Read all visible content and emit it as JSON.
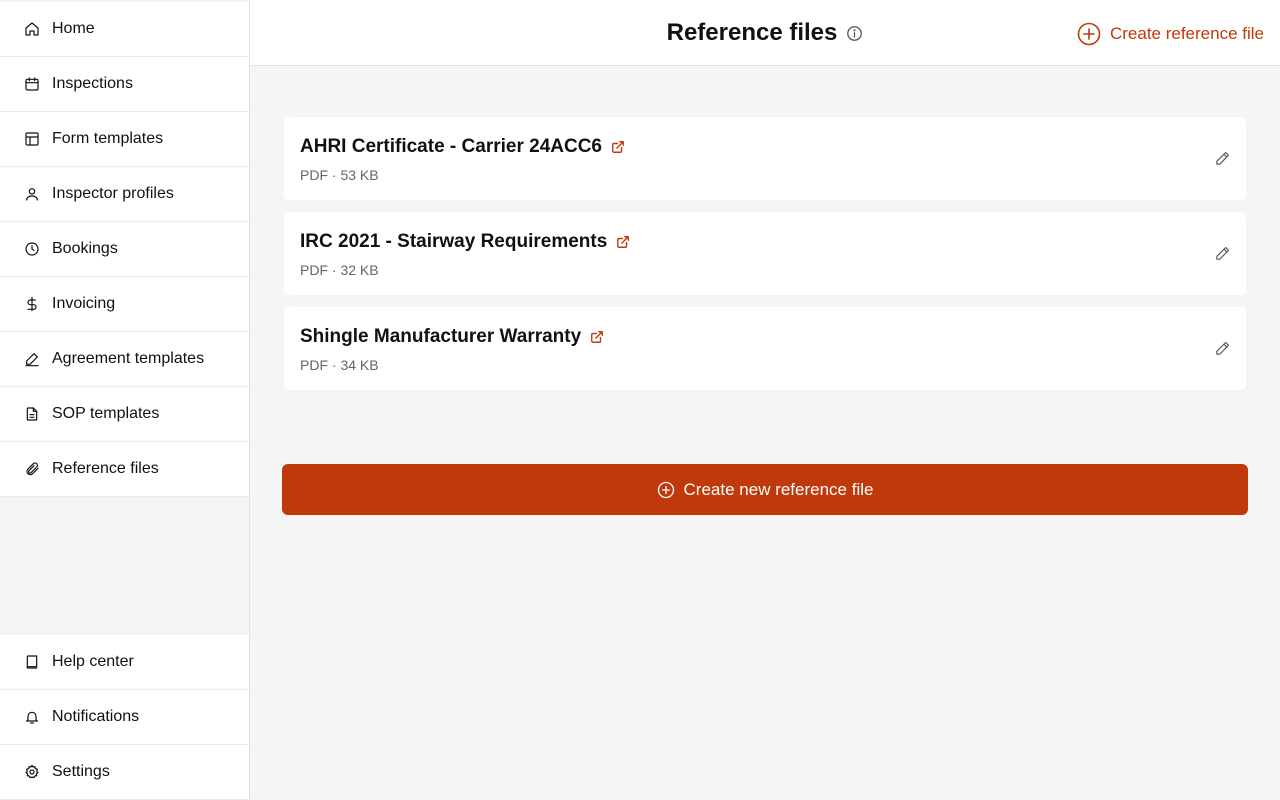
{
  "sidebar": {
    "items": [
      {
        "label": "Home",
        "icon": "home-icon"
      },
      {
        "label": "Inspections",
        "icon": "calendar-icon"
      },
      {
        "label": "Form templates",
        "icon": "layout-icon"
      },
      {
        "label": "Inspector profiles",
        "icon": "user-icon"
      },
      {
        "label": "Bookings",
        "icon": "clock-icon"
      },
      {
        "label": "Invoicing",
        "icon": "dollar-icon"
      },
      {
        "label": "Agreement templates",
        "icon": "signature-icon"
      },
      {
        "label": "SOP templates",
        "icon": "document-icon"
      },
      {
        "label": "Reference files",
        "icon": "paperclip-icon"
      }
    ],
    "bottom_items": [
      {
        "label": "Help center",
        "icon": "book-icon"
      },
      {
        "label": "Notifications",
        "icon": "bell-icon"
      },
      {
        "label": "Settings",
        "icon": "gear-icon"
      }
    ]
  },
  "header": {
    "title": "Reference files",
    "create_label": "Create reference file"
  },
  "files": [
    {
      "name": "AHRI Certificate - Carrier 24ACC6",
      "meta": "PDF · 53 KB"
    },
    {
      "name": "IRC 2021 - Stairway Requirements",
      "meta": "PDF · 32 KB"
    },
    {
      "name": "Shingle Manufacturer Warranty",
      "meta": "PDF · 34 KB"
    }
  ],
  "primary_button": {
    "label": "Create new reference file"
  },
  "colors": {
    "accent": "#c0390b",
    "background": "#f5f5f5",
    "card": "#ffffff"
  }
}
